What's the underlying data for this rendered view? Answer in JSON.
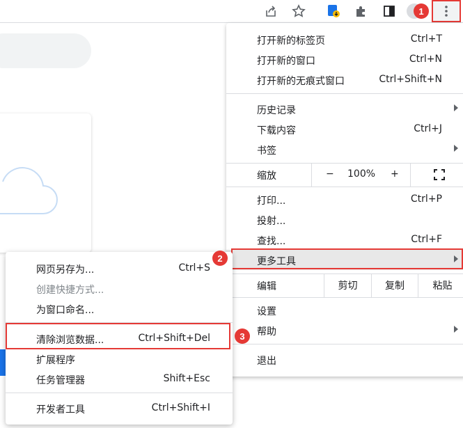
{
  "main_menu": {
    "items": [
      {
        "label": "打开新的标签页",
        "shortcut": "Ctrl+T"
      },
      {
        "label": "打开新的窗口",
        "shortcut": "Ctrl+N"
      },
      {
        "label": "打开新的无痕式窗口",
        "shortcut": "Ctrl+Shift+N"
      },
      {
        "label": "历史记录",
        "shortcut": ""
      },
      {
        "label": "下载内容",
        "shortcut": "Ctrl+J"
      },
      {
        "label": "书签",
        "shortcut": ""
      },
      {
        "label": "打印...",
        "shortcut": "Ctrl+P"
      },
      {
        "label": "投射...",
        "shortcut": ""
      },
      {
        "label": "查找...",
        "shortcut": "Ctrl+F"
      },
      {
        "label": "更多工具",
        "shortcut": ""
      },
      {
        "label": "设置",
        "shortcut": ""
      },
      {
        "label": "帮助",
        "shortcut": ""
      },
      {
        "label": "退出",
        "shortcut": ""
      }
    ],
    "zoom": {
      "label": "缩放",
      "minus": "−",
      "value": "100%",
      "plus": "+"
    },
    "edit": {
      "label": "编辑",
      "cut": "剪切",
      "copy": "复制",
      "paste": "粘贴"
    }
  },
  "sub_menu": {
    "items": [
      {
        "label": "网页另存为...",
        "shortcut": "Ctrl+S"
      },
      {
        "label": "创建快捷方式...",
        "shortcut": ""
      },
      {
        "label": "为窗口命名...",
        "shortcut": ""
      },
      {
        "label": "清除浏览数据...",
        "shortcut": "Ctrl+Shift+Del"
      },
      {
        "label": "扩展程序",
        "shortcut": ""
      },
      {
        "label": "任务管理器",
        "shortcut": "Shift+Esc"
      },
      {
        "label": "开发者工具",
        "shortcut": "Ctrl+Shift+I"
      }
    ]
  },
  "badges": {
    "one": "1",
    "two": "2",
    "three": "3"
  },
  "colors": {
    "highlight": "#e53935",
    "accent": "#1a73e8"
  }
}
